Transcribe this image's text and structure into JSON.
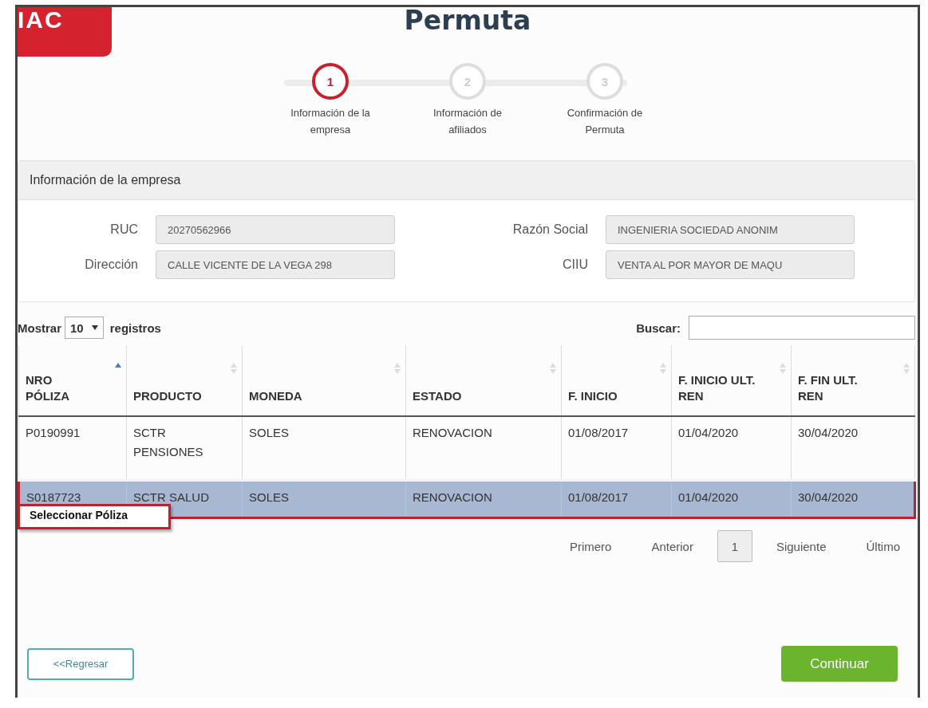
{
  "logo_text": "IAC",
  "title": "Permuta",
  "steps": [
    {
      "number": "1",
      "label": "Información de la empresa",
      "selected": true
    },
    {
      "number": "2",
      "label": "Información de afiliados",
      "selected": false
    },
    {
      "number": "3",
      "label": "Confirmación de Permuta",
      "selected": false
    }
  ],
  "panel": {
    "title": "Información de la empresa",
    "fields": [
      {
        "label": "RUC",
        "value": "20270562966"
      },
      {
        "label": "Razón Social",
        "value": "INGENIERIA SOCIEDAD ANONIM"
      },
      {
        "label": "Dirección",
        "value": "CALLE VICENTE DE LA VEGA 298"
      },
      {
        "label": "CIIU",
        "value": "VENTA AL POR MAYOR DE MAQU"
      }
    ]
  },
  "table_controls": {
    "show_prefix": "Mostrar",
    "page_size": "10",
    "show_suffix": "registros",
    "search_label": "Buscar:"
  },
  "table": {
    "columns": [
      {
        "label": "NRO PÓLIZA",
        "sorted": true
      },
      {
        "label": "PRODUCTO",
        "sorted": false
      },
      {
        "label": "MONEDA",
        "sorted": false
      },
      {
        "label": "ESTADO",
        "sorted": false
      },
      {
        "label": "F. INICIO",
        "sorted": false
      },
      {
        "label": "F. INICIO ULT. REN",
        "sorted": false
      },
      {
        "label": "F. FIN ULT. REN",
        "sorted": false
      }
    ],
    "rows": [
      {
        "selected": false,
        "cells": [
          "P0190991",
          "SCTR PENSIONES",
          "SOLES",
          "RENOVACION",
          "01/08/2017",
          "01/04/2020",
          "30/04/2020"
        ]
      },
      {
        "selected": true,
        "cells": [
          "S0187723",
          "SCTR SALUD",
          "SOLES",
          "RENOVACION",
          "01/08/2017",
          "01/04/2020",
          "30/04/2020"
        ]
      }
    ]
  },
  "tooltip": "Seleccionar Póliza",
  "pagination": [
    {
      "label": "Primero",
      "kind": "link"
    },
    {
      "label": "Anterior",
      "kind": "link"
    },
    {
      "label": "1",
      "kind": "page"
    },
    {
      "label": "Siguiente",
      "kind": "link"
    },
    {
      "label": "Último",
      "kind": "link"
    }
  ],
  "buttons": [
    {
      "label": "<<Regresar",
      "kind": "outline"
    },
    {
      "label": "Continuar",
      "kind": "primary"
    }
  ]
}
